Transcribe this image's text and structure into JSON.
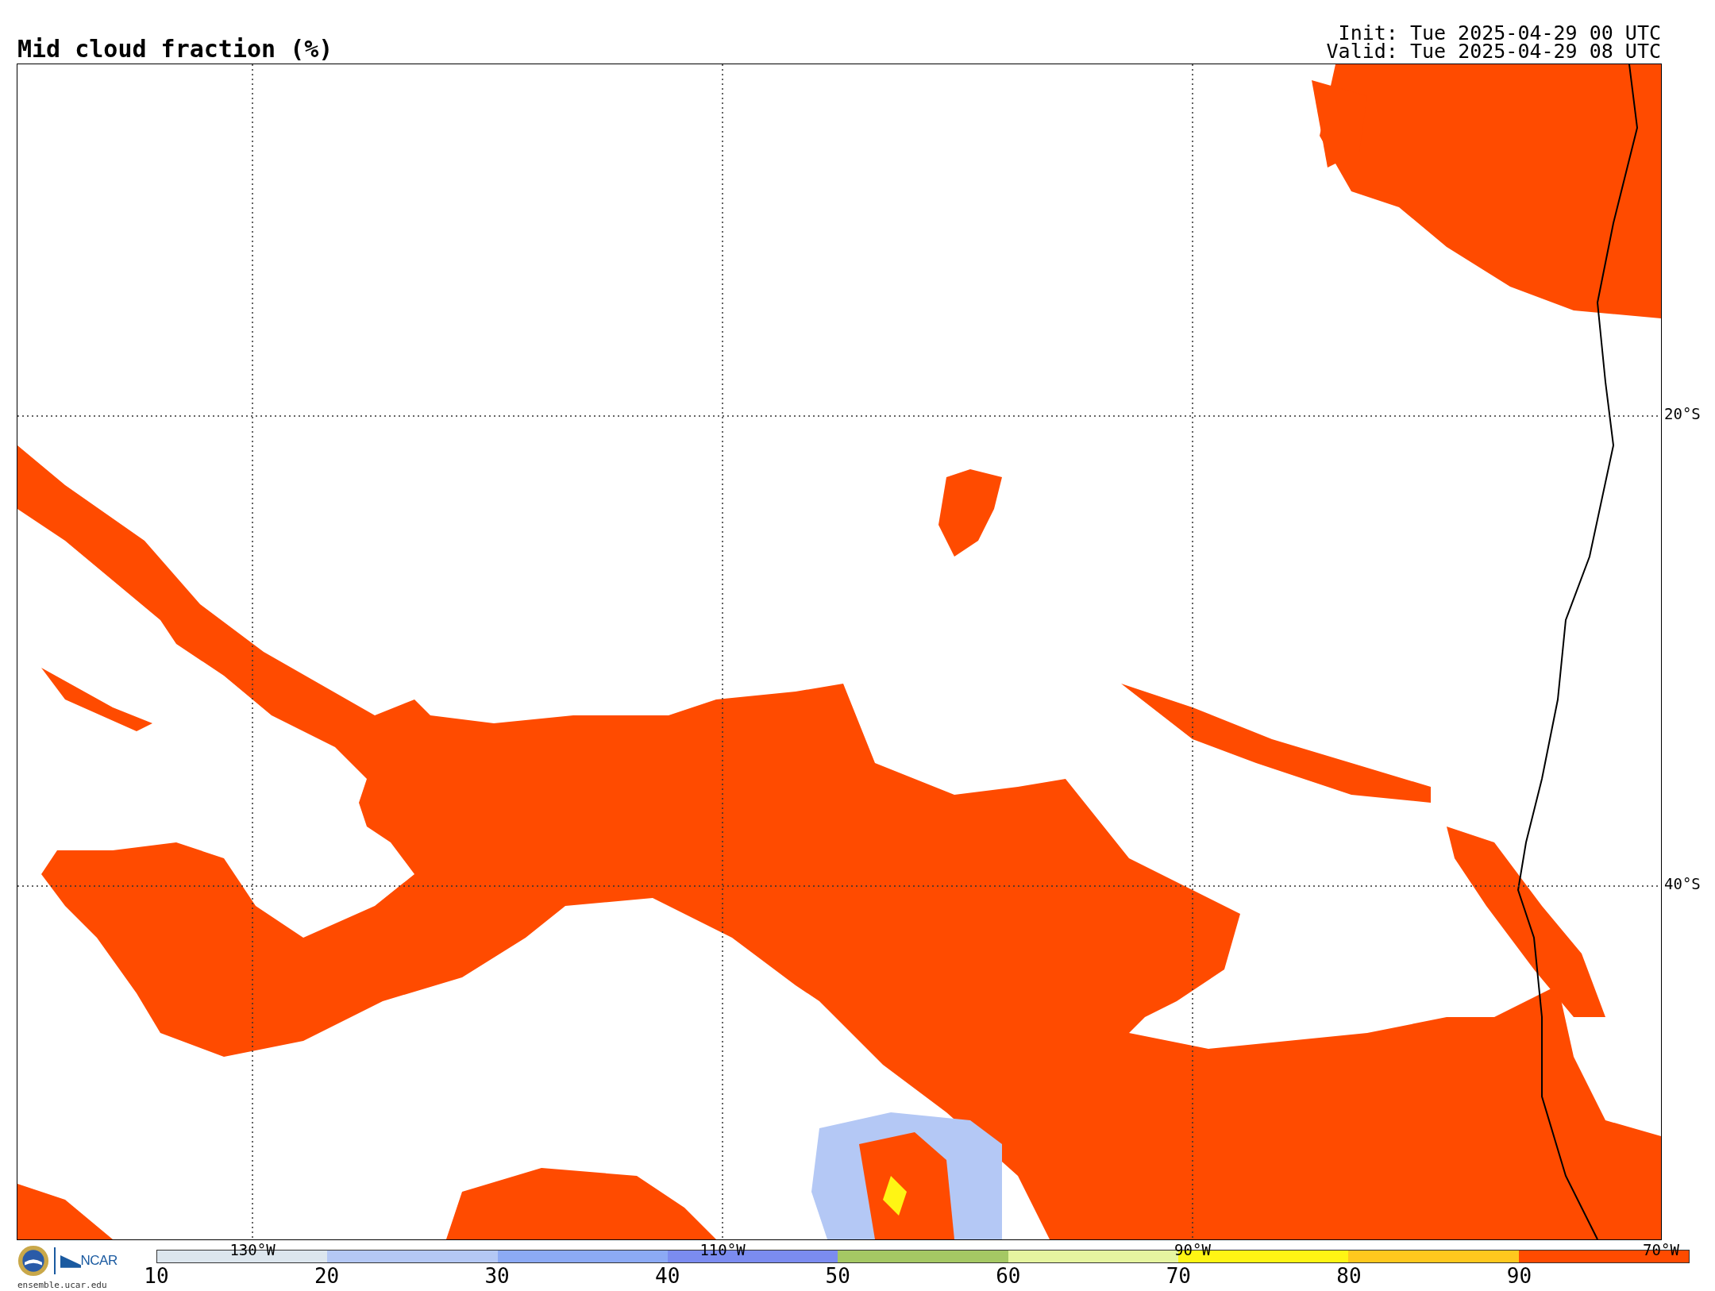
{
  "title": "Mid cloud fraction (%)",
  "init": "Init: Tue 2025-04-29 00 UTC",
  "valid": "Valid: Tue 2025-04-29 08 UTC",
  "map": {
    "lat_labels": [
      "20°S",
      "40°S"
    ],
    "lon_labels": [
      "130°W",
      "110°W",
      "90°W",
      "70°W"
    ]
  },
  "logo": {
    "name": "NCAR",
    "site": "ensemble.ucar.edu"
  },
  "colorbar": [
    {
      "label": "10",
      "color": "#dce6ee"
    },
    {
      "label": "20",
      "color": "#b4c8f5"
    },
    {
      "label": "30",
      "color": "#8caaf5"
    },
    {
      "label": "40",
      "color": "#7b8cf0"
    },
    {
      "label": "50",
      "color": "#a5c864"
    },
    {
      "label": "60",
      "color": "#e6f5a0"
    },
    {
      "label": "70",
      "color": "#fff514"
    },
    {
      "label": "80",
      "color": "#ffc81e"
    },
    {
      "label": "90",
      "color": "#ff4b00"
    }
  ]
}
